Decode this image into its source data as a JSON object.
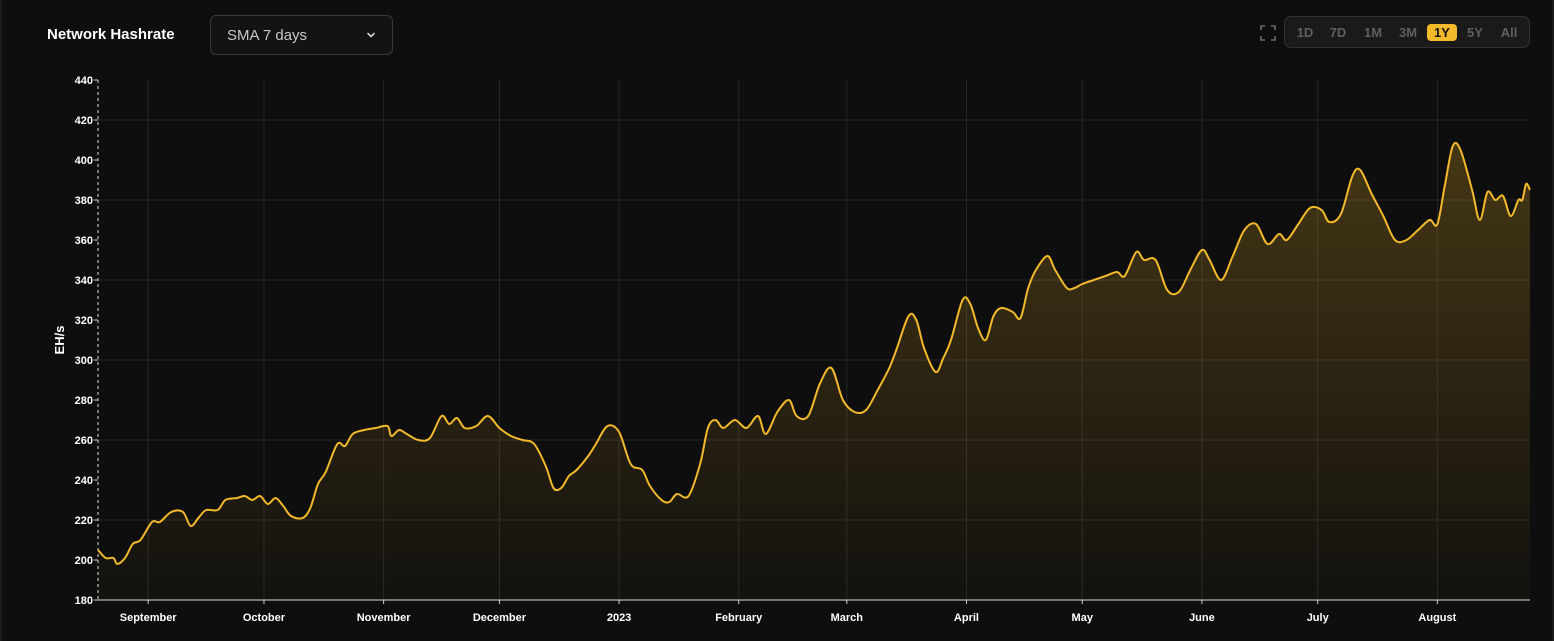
{
  "header": {
    "title": "Network Hashrate",
    "dropdown": {
      "value": "SMA 7 days",
      "icon": "chevron-down-icon"
    },
    "fullscreen_icon": "fullscreen-icon",
    "ranges": [
      {
        "label": "1D",
        "active": false
      },
      {
        "label": "7D",
        "active": false
      },
      {
        "label": "1M",
        "active": false
      },
      {
        "label": "3M",
        "active": false
      },
      {
        "label": "1Y",
        "active": true
      },
      {
        "label": "5Y",
        "active": false
      },
      {
        "label": "All",
        "active": false
      }
    ]
  },
  "colors": {
    "background": "#0e0e0e",
    "line": "#f3b92a",
    "grid": "#262626",
    "accent": "#f3b92a"
  },
  "chart_data": {
    "type": "area",
    "title": "Network Hashrate",
    "ylabel": "EH/s",
    "xlabel": "",
    "ylim": [
      180,
      440
    ],
    "yticks": [
      180,
      200,
      220,
      240,
      260,
      280,
      300,
      320,
      340,
      360,
      380,
      400,
      420,
      440
    ],
    "xlim": [
      "2022-08-19",
      "2023-08-25"
    ],
    "xticks": [
      {
        "date": "2022-09-01",
        "label": "September"
      },
      {
        "date": "2022-10-01",
        "label": "October"
      },
      {
        "date": "2022-11-01",
        "label": "November"
      },
      {
        "date": "2022-12-01",
        "label": "December"
      },
      {
        "date": "2023-01-01",
        "label": "2023"
      },
      {
        "date": "2023-02-01",
        "label": "February"
      },
      {
        "date": "2023-03-01",
        "label": "March"
      },
      {
        "date": "2023-04-01",
        "label": "April"
      },
      {
        "date": "2023-05-01",
        "label": "May"
      },
      {
        "date": "2023-06-01",
        "label": "June"
      },
      {
        "date": "2023-07-01",
        "label": "July"
      },
      {
        "date": "2023-08-01",
        "label": "August"
      }
    ],
    "grid": true,
    "series": [
      {
        "name": "",
        "points": [
          [
            "2022-08-19",
            205
          ],
          [
            "2022-08-21",
            201
          ],
          [
            "2022-08-23",
            201
          ],
          [
            "2022-08-24",
            198
          ],
          [
            "2022-08-26",
            201
          ],
          [
            "2022-08-28",
            208
          ],
          [
            "2022-08-30",
            210
          ],
          [
            "2022-09-02",
            219
          ],
          [
            "2022-09-04",
            219
          ],
          [
            "2022-09-07",
            224
          ],
          [
            "2022-09-10",
            224
          ],
          [
            "2022-09-12",
            217
          ],
          [
            "2022-09-14",
            221
          ],
          [
            "2022-09-16",
            225
          ],
          [
            "2022-09-19",
            225
          ],
          [
            "2022-09-21",
            230
          ],
          [
            "2022-09-24",
            231
          ],
          [
            "2022-09-26",
            232
          ],
          [
            "2022-09-28",
            230
          ],
          [
            "2022-09-30",
            232
          ],
          [
            "2022-10-02",
            228
          ],
          [
            "2022-10-04",
            231
          ],
          [
            "2022-10-06",
            227
          ],
          [
            "2022-10-08",
            222
          ],
          [
            "2022-10-11",
            221
          ],
          [
            "2022-10-13",
            226
          ],
          [
            "2022-10-15",
            238
          ],
          [
            "2022-10-17",
            244
          ],
          [
            "2022-10-20",
            258
          ],
          [
            "2022-10-22",
            257
          ],
          [
            "2022-10-24",
            263
          ],
          [
            "2022-10-27",
            265
          ],
          [
            "2022-10-30",
            266
          ],
          [
            "2022-11-02",
            267
          ],
          [
            "2022-11-03",
            262
          ],
          [
            "2022-11-05",
            265
          ],
          [
            "2022-11-07",
            263
          ],
          [
            "2022-11-10",
            260
          ],
          [
            "2022-11-13",
            261
          ],
          [
            "2022-11-16",
            272
          ],
          [
            "2022-11-18",
            268
          ],
          [
            "2022-11-20",
            271
          ],
          [
            "2022-11-22",
            266
          ],
          [
            "2022-11-25",
            267
          ],
          [
            "2022-11-28",
            272
          ],
          [
            "2022-12-01",
            266
          ],
          [
            "2022-12-04",
            262
          ],
          [
            "2022-12-07",
            260
          ],
          [
            "2022-12-10",
            258
          ],
          [
            "2022-12-13",
            247
          ],
          [
            "2022-12-15",
            236
          ],
          [
            "2022-12-17",
            236
          ],
          [
            "2022-12-19",
            242
          ],
          [
            "2022-12-21",
            245
          ],
          [
            "2022-12-24",
            252
          ],
          [
            "2022-12-26",
            258
          ],
          [
            "2022-12-29",
            267
          ],
          [
            "2023-01-01",
            264
          ],
          [
            "2023-01-04",
            248
          ],
          [
            "2023-01-07",
            245
          ],
          [
            "2023-01-09",
            237
          ],
          [
            "2023-01-12",
            230
          ],
          [
            "2023-01-14",
            229
          ],
          [
            "2023-01-16",
            233
          ],
          [
            "2023-01-19",
            232
          ],
          [
            "2023-01-22",
            248
          ],
          [
            "2023-01-24",
            266
          ],
          [
            "2023-01-26",
            270
          ],
          [
            "2023-01-28",
            266
          ],
          [
            "2023-01-31",
            270
          ],
          [
            "2023-02-03",
            266
          ],
          [
            "2023-02-06",
            272
          ],
          [
            "2023-02-08",
            263
          ],
          [
            "2023-02-11",
            274
          ],
          [
            "2023-02-14",
            280
          ],
          [
            "2023-02-16",
            272
          ],
          [
            "2023-02-19",
            272
          ],
          [
            "2023-02-22",
            288
          ],
          [
            "2023-02-25",
            296
          ],
          [
            "2023-02-28",
            280
          ],
          [
            "2023-03-03",
            274
          ],
          [
            "2023-03-06",
            275
          ],
          [
            "2023-03-09",
            285
          ],
          [
            "2023-03-12",
            296
          ],
          [
            "2023-03-14",
            306
          ],
          [
            "2023-03-17",
            322
          ],
          [
            "2023-03-19",
            320
          ],
          [
            "2023-03-21",
            306
          ],
          [
            "2023-03-24",
            294
          ],
          [
            "2023-03-26",
            301
          ],
          [
            "2023-03-28",
            310
          ],
          [
            "2023-03-31",
            330
          ],
          [
            "2023-04-02",
            328
          ],
          [
            "2023-04-04",
            316
          ],
          [
            "2023-04-06",
            310
          ],
          [
            "2023-04-08",
            322
          ],
          [
            "2023-04-10",
            326
          ],
          [
            "2023-04-13",
            324
          ],
          [
            "2023-04-15",
            321
          ],
          [
            "2023-04-17",
            336
          ],
          [
            "2023-04-19",
            345
          ],
          [
            "2023-04-22",
            352
          ],
          [
            "2023-04-24",
            345
          ],
          [
            "2023-04-27",
            336
          ],
          [
            "2023-04-29",
            336
          ],
          [
            "2023-05-01",
            338
          ],
          [
            "2023-05-04",
            340
          ],
          [
            "2023-05-07",
            342
          ],
          [
            "2023-05-10",
            344
          ],
          [
            "2023-05-12",
            342
          ],
          [
            "2023-05-15",
            354
          ],
          [
            "2023-05-17",
            350
          ],
          [
            "2023-05-20",
            350
          ],
          [
            "2023-05-23",
            335
          ],
          [
            "2023-05-26",
            334
          ],
          [
            "2023-05-29",
            345
          ],
          [
            "2023-06-01",
            355
          ],
          [
            "2023-06-03",
            350
          ],
          [
            "2023-06-06",
            340
          ],
          [
            "2023-06-09",
            352
          ],
          [
            "2023-06-12",
            365
          ],
          [
            "2023-06-15",
            368
          ],
          [
            "2023-06-18",
            358
          ],
          [
            "2023-06-21",
            363
          ],
          [
            "2023-06-23",
            360
          ],
          [
            "2023-06-26",
            368
          ],
          [
            "2023-06-29",
            376
          ],
          [
            "2023-07-02",
            375
          ],
          [
            "2023-07-04",
            369
          ],
          [
            "2023-07-07",
            373
          ],
          [
            "2023-07-10",
            392
          ],
          [
            "2023-07-12",
            395
          ],
          [
            "2023-07-15",
            383
          ],
          [
            "2023-07-18",
            372
          ],
          [
            "2023-07-21",
            360
          ],
          [
            "2023-07-24",
            360
          ],
          [
            "2023-07-27",
            365
          ],
          [
            "2023-07-30",
            370
          ],
          [
            "2023-08-01",
            368
          ],
          [
            "2023-08-03",
            388
          ],
          [
            "2023-08-05",
            407
          ],
          [
            "2023-08-07",
            405
          ],
          [
            "2023-08-10",
            385
          ],
          [
            "2023-08-12",
            370
          ],
          [
            "2023-08-14",
            384
          ],
          [
            "2023-08-16",
            380
          ],
          [
            "2023-08-18",
            382
          ],
          [
            "2023-08-20",
            372
          ],
          [
            "2023-08-22",
            380
          ],
          [
            "2023-08-23",
            380
          ],
          [
            "2023-08-24",
            388
          ],
          [
            "2023-08-25",
            385
          ]
        ]
      }
    ]
  }
}
